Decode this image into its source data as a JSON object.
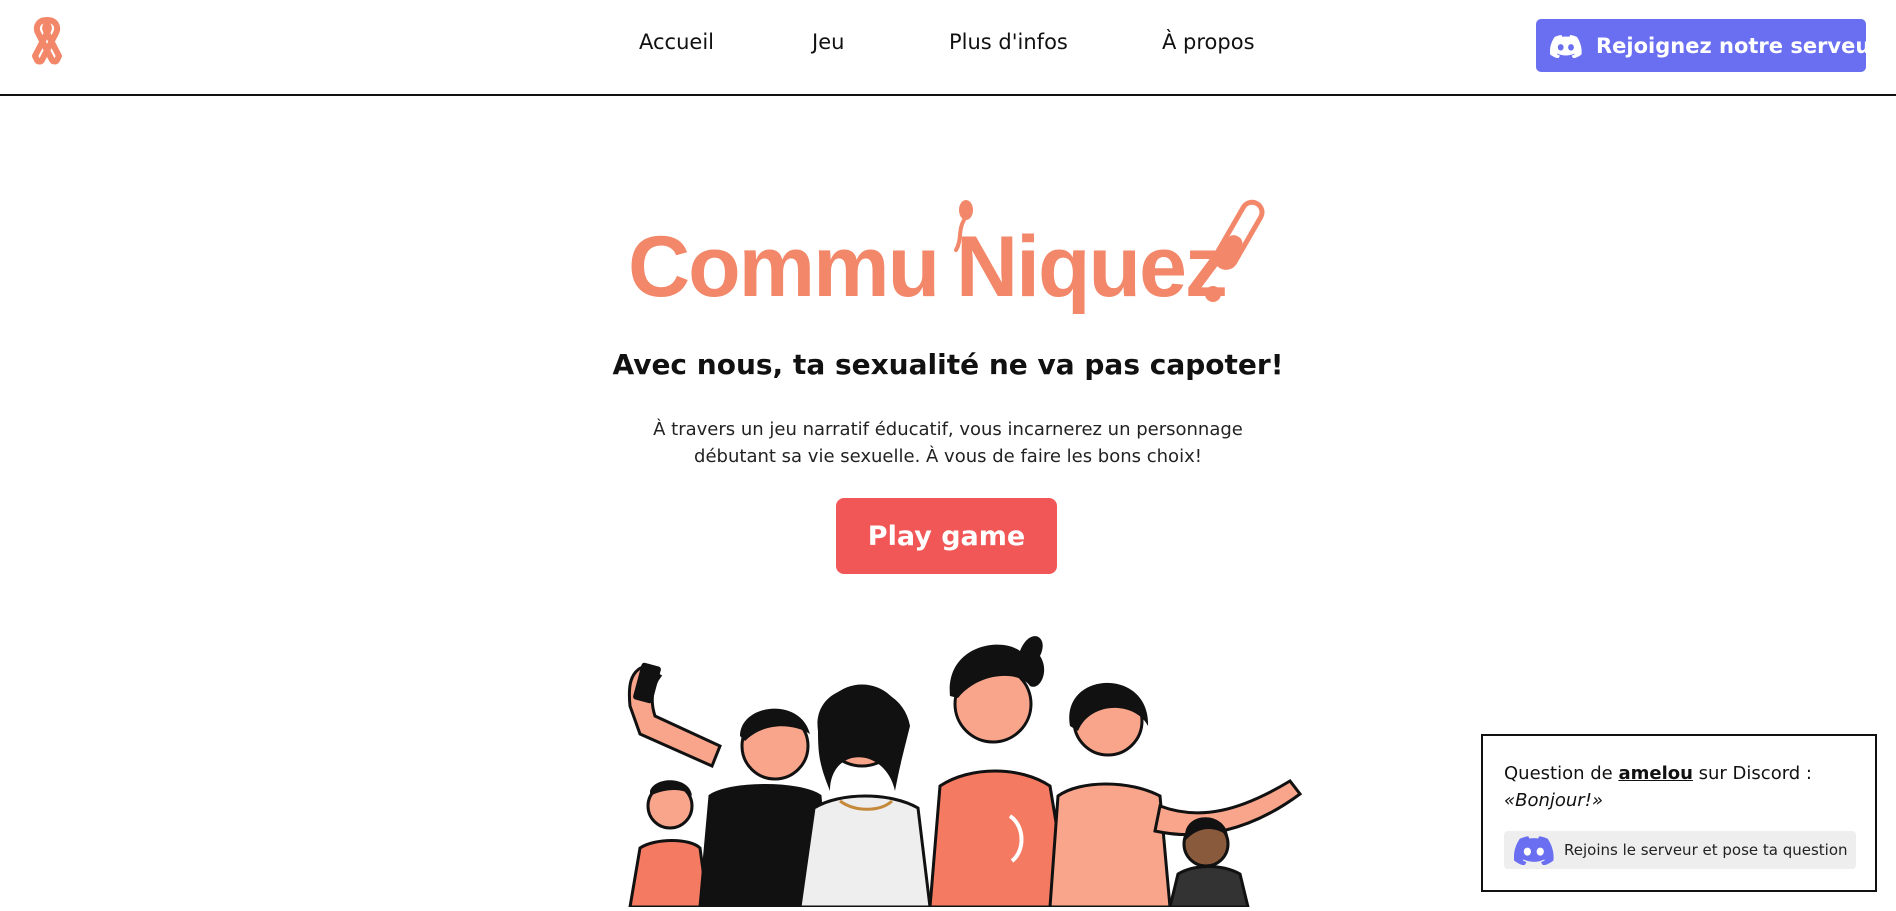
{
  "header": {
    "logo_icon": "ribbon-icon",
    "nav": [
      {
        "label": "Accueil"
      },
      {
        "label": "Jeu"
      },
      {
        "label": "Plus d'infos"
      },
      {
        "label": "À propos"
      }
    ],
    "discord_button": {
      "icon": "discord-icon",
      "label": "Rejoignez notre serveur!"
    }
  },
  "hero": {
    "logo_text": "Commu'Niquez!",
    "tagline": "Avec nous, ta sexualité ne va pas capoter!",
    "intro_line1": "À travers un jeu narratif éducatif, vous incarnerez un personnage",
    "intro_line2": "débutant sa vie sexuelle. À vous de faire les bons choix!",
    "play_button": "Play game"
  },
  "question_card": {
    "prefix": "Question de ",
    "user": "amelou",
    "suffix": " sur Discord :",
    "quote": "«Bonjour!»",
    "join_icon": "discord-icon",
    "join_label": "Rejoins le serveur et pose ta question"
  },
  "colors": {
    "brand_orange": "#f2876a",
    "discord": "#6a6ff1",
    "play_red": "#f25757",
    "shirt_salmon": "#f47a62"
  }
}
